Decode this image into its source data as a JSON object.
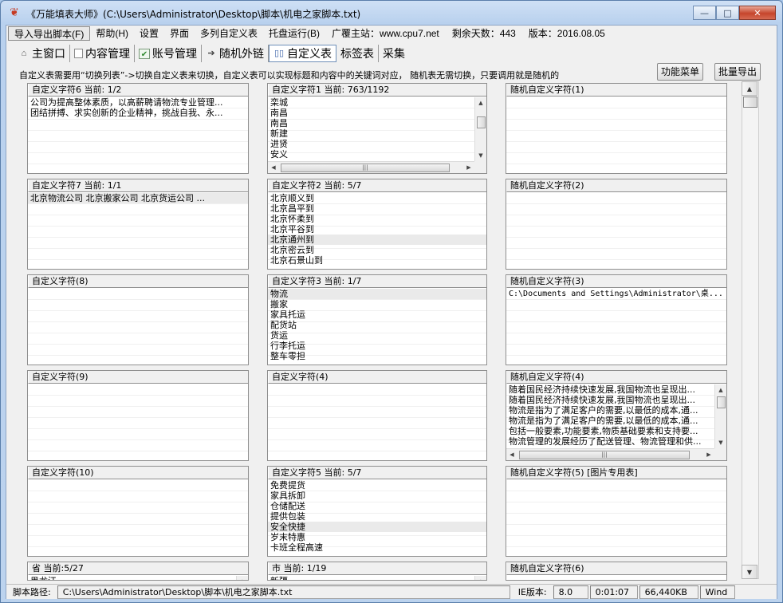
{
  "window": {
    "title": "《万能填表大师》(C:\\Users\\Administrator\\Desktop\\脚本\\机电之家脚本.txt)",
    "minimize": "—",
    "maximize": "□",
    "close": "✕"
  },
  "menu": {
    "items": [
      "导入导出脚本(F)",
      "帮助(H)",
      "设置",
      "界面",
      "多列自定义表",
      "托盘运行(B)"
    ],
    "site": "广覆主站：www.cpu7.net",
    "days_left": "剩余天数：443",
    "version": "版本：2016.08.05"
  },
  "tabs": [
    {
      "label": "主窗口",
      "icon": "home-icon"
    },
    {
      "label": "内容管理",
      "icon": "doc-icon"
    },
    {
      "label": "账号管理",
      "icon": "check-icon"
    },
    {
      "label": "随机外链",
      "icon": "arrow-icon"
    },
    {
      "label": "自定义表",
      "icon": "book-icon"
    },
    {
      "label": "标签表",
      "icon": ""
    },
    {
      "label": "采集",
      "icon": ""
    }
  ],
  "active_tab": "自定义表",
  "info": "自定义表需要用“切换列表”->切换自定义表来切换，自定义表可以实现标题和内容中的关键词对应，  随机表无需切换，只要调用就是随机的",
  "buttons": {
    "func_menu": "功能菜单",
    "batch_export": "批量导出"
  },
  "panels": {
    "c1r1": {
      "title": "自定义字符6  当前: 1/2",
      "lines": [
        "公司为提高整体素质，以高薪聘请物流专业管理...",
        "团结拼搏、求实创新的企业精神，挑战自我、永..."
      ]
    },
    "c1r2": {
      "title": "自定义字符7  当前: 1/1",
      "lines": [
        " 北京物流公司 北京搬家公司 北京货运公司  ..."
      ]
    },
    "c1r3": {
      "title": "自定义字符(8)",
      "lines": []
    },
    "c1r4": {
      "title": "自定义字符(9)",
      "lines": []
    },
    "c1r5": {
      "title": "自定义字符(10)",
      "lines": []
    },
    "c1r6": {
      "title": "省  当前:5/27",
      "lines": [
        "黑龙江"
      ]
    },
    "c2r1": {
      "title": "自定义字符1  当前: 763/1192",
      "lines": [
        "栾城",
        "南昌",
        "南昌",
        "新建",
        "进贤",
        "安义"
      ]
    },
    "c2r2": {
      "title": "自定义字符2  当前: 5/7",
      "lines": [
        "北京顺义到",
        "北京昌平到",
        "北京怀柔到",
        "北京平谷到",
        "北京通州到",
        "北京密云到",
        "北京石景山到"
      ]
    },
    "c2r3": {
      "title": "自定义字符3  当前: 1/7",
      "lines": [
        "物流",
        "搬家",
        "家具托运",
        "配货站",
        "货运",
        "行李托运",
        "整车零担"
      ]
    },
    "c2r4": {
      "title": "自定义字符(4)",
      "lines": []
    },
    "c2r5": {
      "title": "自定义字符5  当前: 5/7",
      "lines": [
        "免费提货",
        "家具拆卸",
        "仓储配送",
        "提供包装",
        "安全快捷",
        "岁末特惠",
        "卡班全程高速"
      ]
    },
    "c2r6": {
      "title": "市  当前: 1/19",
      "lines": [
        "新疆"
      ]
    },
    "c3r1": {
      "title": "随机自定义字符(1)",
      "lines": []
    },
    "c3r2": {
      "title": "随机自定义字符(2)",
      "lines": []
    },
    "c3r3": {
      "title": "随机自定义字符(3)",
      "lines": [
        "C:\\Documents and Settings\\Administrator\\桌..."
      ]
    },
    "c3r4": {
      "title": "随机自定义字符(4)",
      "lines": [
        "随着国民经济持续快速发展,我国物流也呈现出...",
        "随着国民经济持续快速发展,我国物流也呈现出...",
        "物流是指为了满足客户的需要,以最低的成本,通...",
        "物流是指为了满足客户的需要,以最低的成本,通...",
        "包括一般要素,功能要素,物质基础要素和支持要...",
        "物流管理的发展经历了配送管理、物流管理和供..."
      ]
    },
    "c3r5": {
      "title": "随机自定义字符(5) [图片专用表]",
      "lines": []
    },
    "c3r6": {
      "title": "随机自定义字符(6)",
      "lines": []
    }
  },
  "status": {
    "path_label": "脚本路径:",
    "path": "C:\\Users\\Administrator\\Desktop\\脚本\\机电之家脚本.txt",
    "ie_label": "IE版本:",
    "ie": "8.0",
    "time": "0:01:07",
    "memory": "66,440KB",
    "os": "Wind"
  }
}
